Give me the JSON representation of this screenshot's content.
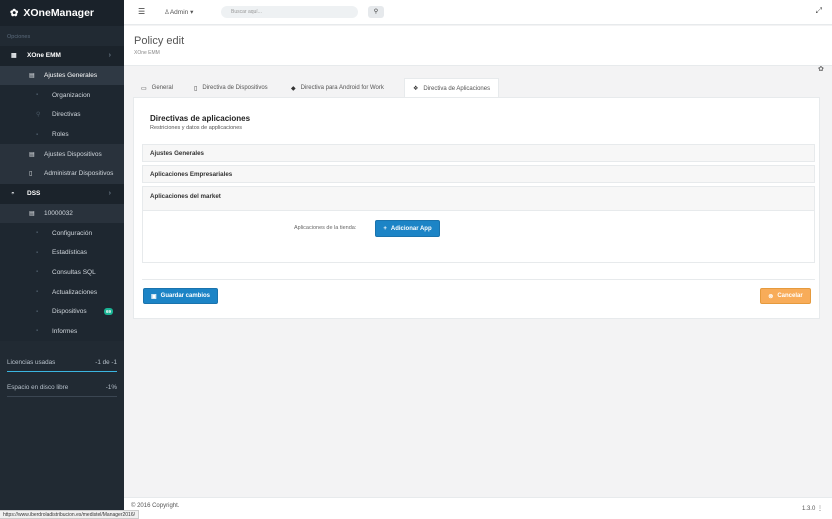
{
  "brand": {
    "title": "XOneManager"
  },
  "sidebar": {
    "section_label": "Opciones",
    "items": [
      {
        "label": "XOne EMM",
        "level": 1,
        "chevron": "›"
      },
      {
        "label": "Ajustes Generales",
        "level": 2,
        "active": true
      },
      {
        "label": "Organizacion",
        "level": 3
      },
      {
        "label": "Directivas",
        "level": 3
      },
      {
        "label": "Roles",
        "level": 3
      },
      {
        "label": "Ajustes Dispositivos",
        "level": 2
      },
      {
        "label": "Administrar Dispositivos",
        "level": 2
      },
      {
        "label": "DSS",
        "level": 1,
        "chevron": "›"
      },
      {
        "label": "10000032",
        "level": 2
      },
      {
        "label": "Configuración",
        "level": 3
      },
      {
        "label": "Estadísticas",
        "level": 3
      },
      {
        "label": "Consultas SQL",
        "level": 3
      },
      {
        "label": "Actualizaciones",
        "level": 3
      },
      {
        "label": "Dispositivos",
        "level": 3,
        "badge": "69"
      },
      {
        "label": "Informes",
        "level": 3
      }
    ],
    "licenses": {
      "label": "Licencias usadas",
      "value": "-1 de -1"
    },
    "disk": {
      "label": "Espacio en disco libre",
      "value": "-1%"
    }
  },
  "topbar": {
    "user": "Admin",
    "search_placeholder": "Buscar aquí..."
  },
  "page": {
    "title": "Policy edit",
    "subtitle": "XOne EMM"
  },
  "tabs": [
    {
      "label": "General"
    },
    {
      "label": "Directiva de Dispositivos"
    },
    {
      "label": "Directiva para Android for Work"
    },
    {
      "label": "Directiva de Aplicaciones",
      "active": true
    }
  ],
  "panel": {
    "title": "Directivas de aplicaciones",
    "subtitle": "Restriciones y datos de applicaciones",
    "accordions": [
      "Ajustes Generales",
      "Aplicaciones Empresariales",
      "Aplicaciones del market"
    ],
    "store_label": "Aplicaciones de la tienda:",
    "add_button": "Adicionar App",
    "save_button": "Guardar cambios",
    "cancel_button": "Cancelar"
  },
  "footer": {
    "copyright": "© 2016 Copyright.",
    "version": "1.3.0",
    "status_url": "https://www.iberdroladistribucion.es/medistel/Manager2016/"
  },
  "colors": {
    "sidebar_bg": "#212a33",
    "primary": "#1c84c6",
    "warning": "#f8ac59",
    "badge": "#1ab394"
  }
}
